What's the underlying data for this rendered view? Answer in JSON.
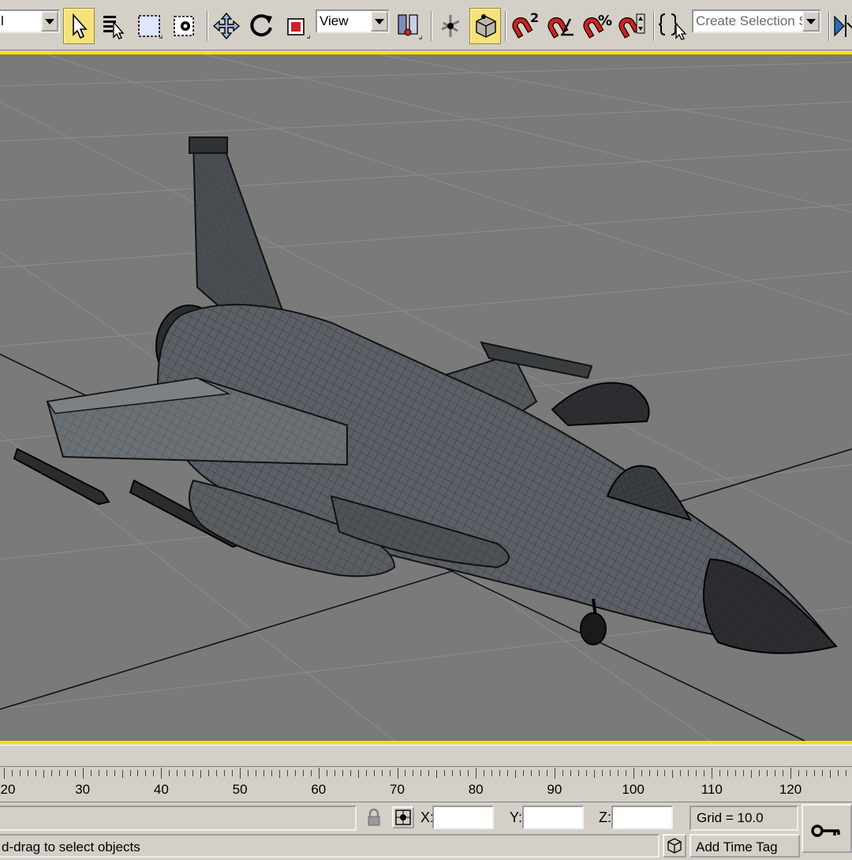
{
  "toolbar": {
    "selection_filter_value": "l",
    "reference_coord_value": "View",
    "named_selection_placeholder": "Create Selection Set",
    "snap_toggle_label": "2",
    "percent_snap_label": "%"
  },
  "timeline": {
    "tick_labels": [
      "20",
      "30",
      "40",
      "50",
      "60",
      "70",
      "80",
      "90",
      "100",
      "110",
      "120"
    ]
  },
  "status_bar": {
    "x_label": "X:",
    "y_label": "Y:",
    "z_label": "Z:",
    "x_value": "",
    "y_value": "",
    "z_value": "",
    "grid_text": "Grid = 10.0",
    "prompt_text": "d-drag to select objects",
    "add_time_tag_label": "Add Time Tag"
  },
  "colors": {
    "viewport_active_border": "#f4e300",
    "viewport_background": "#7a7a7a",
    "ui_face": "#d4d0c8",
    "active_button": "#f7e27a"
  }
}
